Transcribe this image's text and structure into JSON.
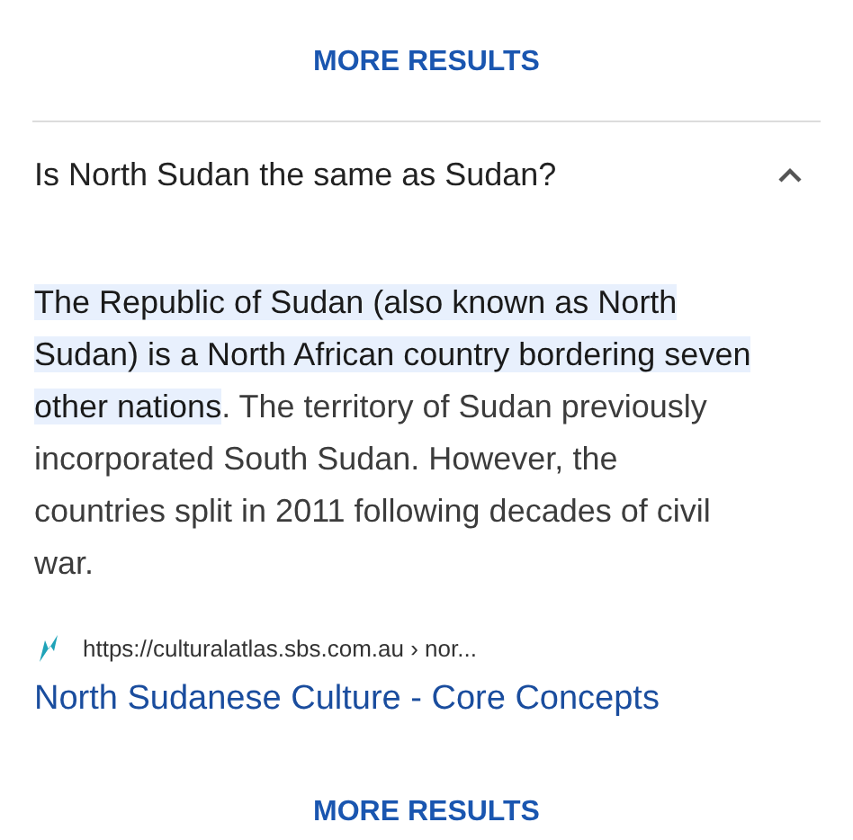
{
  "top_button": "MORE RESULTS",
  "question": {
    "text": "Is North Sudan the same as Sudan?",
    "expanded": true
  },
  "answer": {
    "highlighted": "The Republic of Sudan (also known as North Sudan) is a North African country bordering seven other nations",
    "text": ". The territory of Sudan previously incorporated South Sudan. However, the countries split in 2011 following decades of civil war."
  },
  "source": {
    "url": "https://culturalatlas.sbs.com.au › nor...",
    "title": "North Sudanese Culture - Core Concepts"
  },
  "bottom_button": "MORE RESULTS"
}
